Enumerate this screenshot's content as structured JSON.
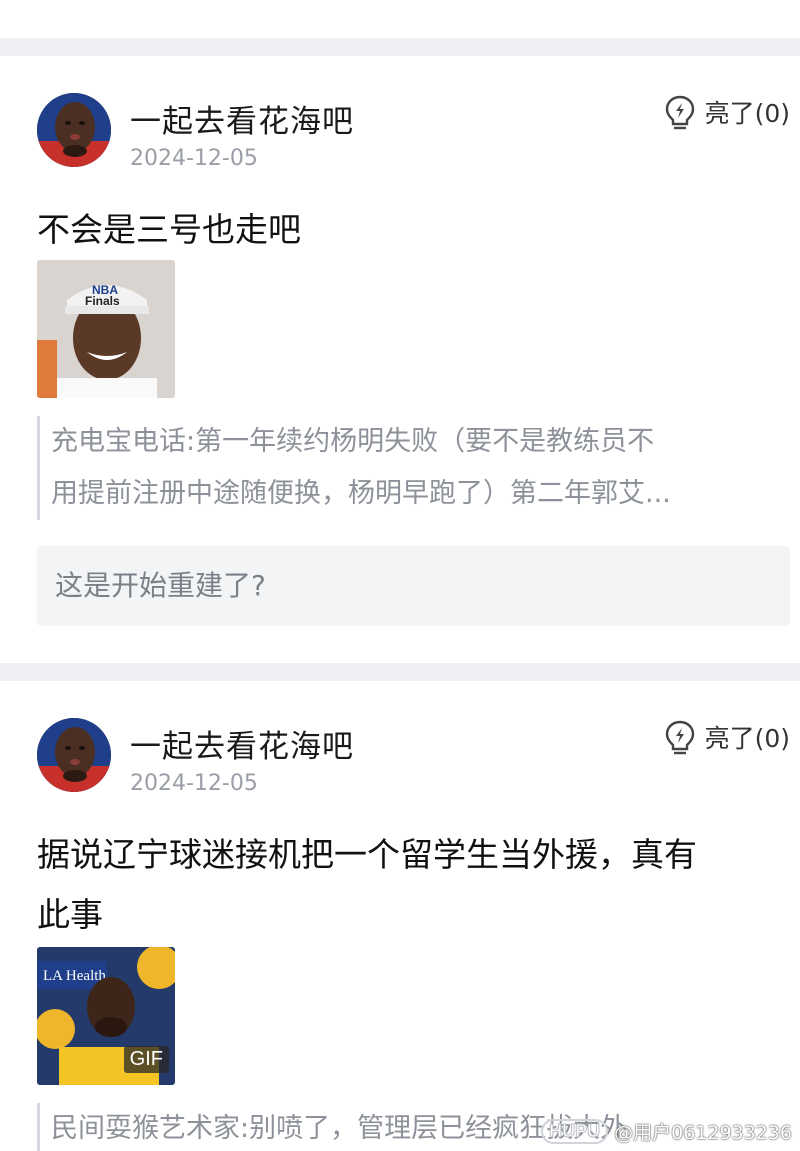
{
  "posts": [
    {
      "username": "一起去看花海吧",
      "date": "2024-12-05",
      "like_label": "亮了(0)",
      "text": "不会是三号也走吧",
      "image": {
        "type": "photo",
        "gif": ""
      },
      "quote": [
        "充电宝电话:第一年续约杨明失败（要不是教练员不",
        "用提前注册中途随便换，杨明早跑了）第二年郭艾..."
      ],
      "reply": "这是开始重建了?"
    },
    {
      "username": "一起去看花海吧",
      "date": "2024-12-05",
      "like_label": "亮了(0)",
      "text_lines": [
        "据说辽宁球迷接机把一个留学生当外援，真有",
        "此事"
      ],
      "image": {
        "type": "gif",
        "gif": "GIF"
      },
      "quote": [
        "民间耍猴艺术家:别喷了，管理层已经疯狂拔大外"
      ],
      "reply": ""
    }
  ],
  "watermark": {
    "logo": "HUPU",
    "user": "@用户0612933236"
  },
  "colors": {
    "divider": "#eeeff2",
    "date": "#9a9ea6",
    "quote": "#8d9199",
    "reply_bg": "#f3f4f6"
  }
}
